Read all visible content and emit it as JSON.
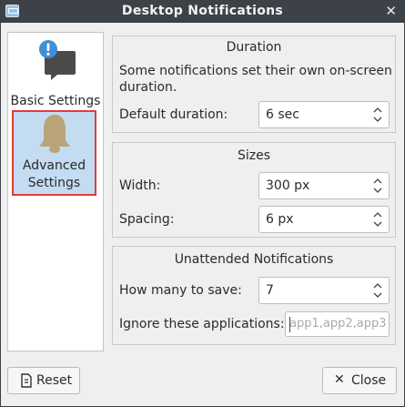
{
  "window": {
    "title": "Desktop Notifications",
    "close_glyph": "✕"
  },
  "sidebar": {
    "items": [
      {
        "label": "Basic Settings",
        "icon": "notification-alert-icon",
        "selected": false
      },
      {
        "label_line1": "Advanced",
        "label_line2": "Settings",
        "icon": "bell-icon",
        "selected": true
      }
    ]
  },
  "duration": {
    "title": "Duration",
    "description_line1": "Some notifications set their own on-screen",
    "description_line2": "duration.",
    "default_label": "Default duration:",
    "default_value": "6 sec"
  },
  "sizes": {
    "title": "Sizes",
    "width_label": "Width:",
    "width_value": "300 px",
    "spacing_label": "Spacing:",
    "spacing_value": "6 px"
  },
  "unattended": {
    "title": "Unattended Notifications",
    "save_label": "How many to save:",
    "save_value": "7",
    "ignore_label": "Ignore these applications:",
    "ignore_placeholder": "app1,app2,app3"
  },
  "footer": {
    "reset_label": "Reset",
    "close_label": "Close",
    "close_glyph": "✕"
  },
  "colors": {
    "titlebar": "#3c4247",
    "selection": "#c3dcf2",
    "highlight_outline": "#e33b3b",
    "alert_badge": "#3d8fd6"
  }
}
